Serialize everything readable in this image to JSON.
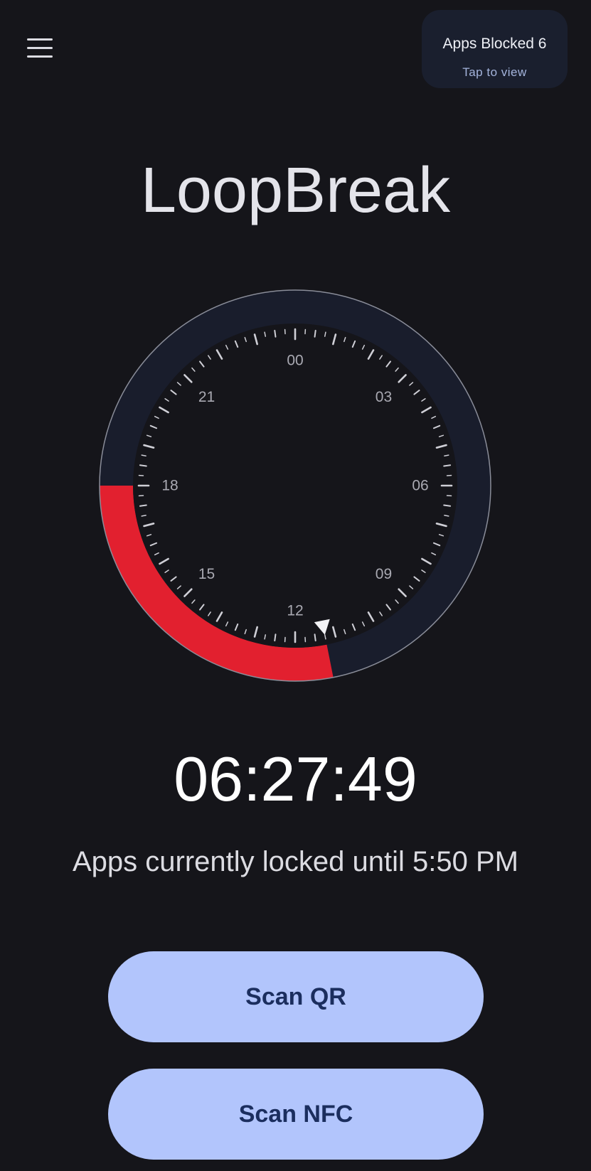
{
  "header": {
    "menu_icon": "hamburger-menu-icon",
    "apps_blocked": {
      "label": "Apps Blocked 6",
      "action": "Tap to view"
    }
  },
  "app_title": "LoopBreak",
  "dial": {
    "hour_labels": [
      "00",
      "03",
      "06",
      "09",
      "12",
      "15",
      "18",
      "21"
    ],
    "locked_range_hours": {
      "start": 11.25,
      "end": 18.0
    },
    "current_hour": 11.25,
    "colors": {
      "ring": "#191d2c",
      "face": "#15151a",
      "locked": "#e2202f",
      "ticks": "#cfcfd6",
      "labels": "#a9a9b2",
      "outline": "#8a8d99",
      "marker": "#f2f2f5"
    }
  },
  "countdown": "06:27:49",
  "lock_status": "Apps currently locked until 5:50 PM",
  "buttons": {
    "scan_qr": "Scan QR",
    "scan_nfc": "Scan NFC"
  }
}
